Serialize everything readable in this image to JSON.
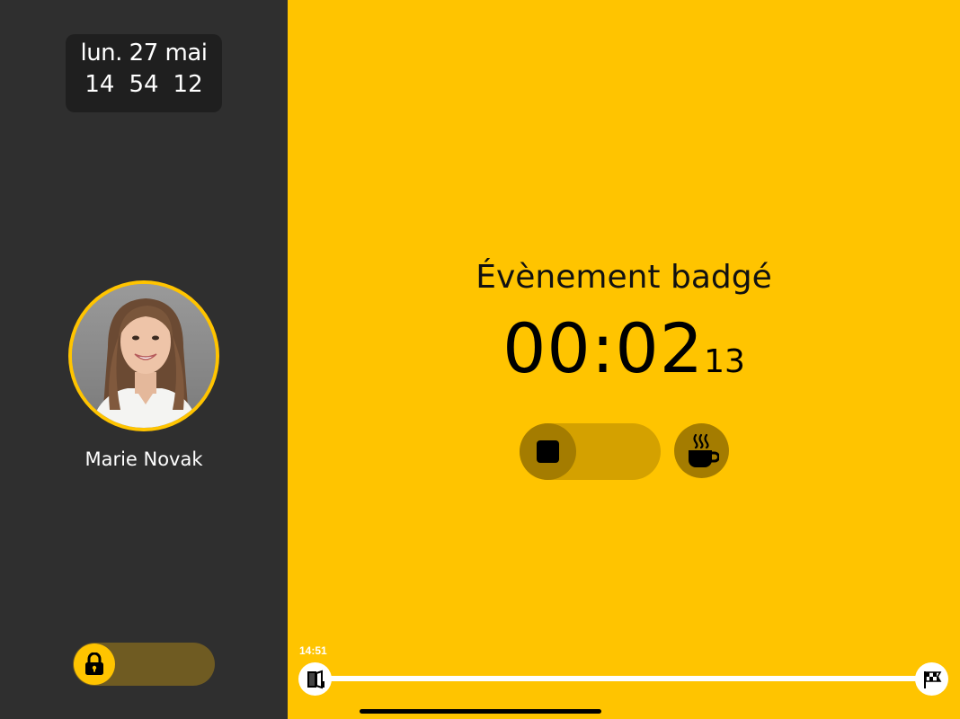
{
  "clock": {
    "date": "lun. 27 mai",
    "hours": "14",
    "minutes": "54",
    "seconds": "12"
  },
  "user": {
    "name": "Marie Novak"
  },
  "event": {
    "title": "Évènement badgé",
    "elapsed_main": "00:02",
    "elapsed_seconds": "13"
  },
  "timeline": {
    "start_time": "14:51",
    "start_icon": "door-exit-icon",
    "end_icon": "checkered-flag-icon"
  },
  "icons": {
    "lock": "lock-icon",
    "stop": "stop-icon",
    "break": "coffee-cup-icon"
  },
  "colors": {
    "accent": "#ffc400",
    "sidebar": "#2f2f2f",
    "knob_dark": "#a47c00"
  }
}
